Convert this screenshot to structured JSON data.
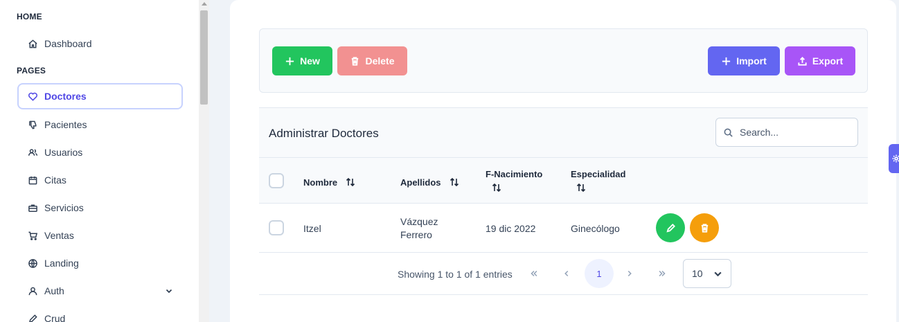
{
  "sidebar": {
    "home_title": "HOME",
    "pages_title": "PAGES",
    "home_items": [
      {
        "label": "Dashboard",
        "icon": "home-icon"
      }
    ],
    "page_items": [
      {
        "label": "Doctores",
        "icon": "heart-icon",
        "active": true
      },
      {
        "label": "Pacientes",
        "icon": "thumbs-down-icon"
      },
      {
        "label": "Usuarios",
        "icon": "users-icon"
      },
      {
        "label": "Citas",
        "icon": "calendar-icon"
      },
      {
        "label": "Servicios",
        "icon": "briefcase-icon"
      },
      {
        "label": "Ventas",
        "icon": "cart-icon"
      },
      {
        "label": "Landing",
        "icon": "globe-icon"
      },
      {
        "label": "Auth",
        "icon": "user-icon",
        "expandable": true
      },
      {
        "label": "Crud",
        "icon": "pencil-icon"
      }
    ]
  },
  "toolbar": {
    "new_label": "New",
    "delete_label": "Delete",
    "import_label": "Import",
    "export_label": "Export"
  },
  "table": {
    "title": "Administrar Doctores",
    "search_placeholder": "Search...",
    "columns": [
      {
        "label": "Nombre"
      },
      {
        "label": "Apellidos"
      },
      {
        "label": "F-Nacimiento"
      },
      {
        "label": "Especialidad"
      }
    ],
    "rows": [
      {
        "nombre": "Itzel",
        "apellidos_1": "Vázquez",
        "apellidos_2": "Ferrero",
        "nacimiento": "19 dic 2022",
        "especialidad": "Ginecólogo"
      }
    ]
  },
  "paginator": {
    "summary": "Showing 1 to 1 of 1 entries",
    "current_page": "1",
    "rows_per_page": "10"
  },
  "colors": {
    "primary": "#6366f1",
    "success": "#22c55e",
    "danger_disabled": "#f29191",
    "help": "#a855f7",
    "warning": "#f59e0b"
  }
}
